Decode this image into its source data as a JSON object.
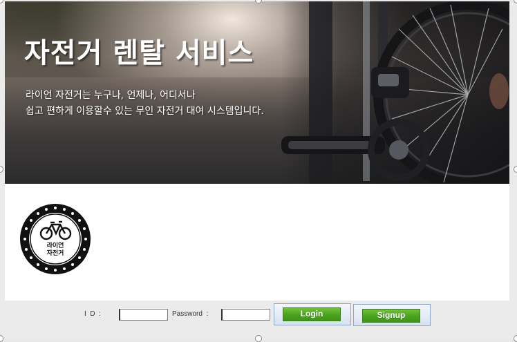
{
  "banner": {
    "title": "자전거 렌탈 서비스",
    "subtitle_line1": "라이언 자전거는 누구나, 언제나, 어디서나",
    "subtitle_line2": "쉽고 편하게 이용할수 있는 무인 자전거 대여 시스템입니다."
  },
  "logo": {
    "line1": "라이언",
    "line2": "자전거"
  },
  "login": {
    "id_label": "I  D  :",
    "id_value": "",
    "password_label": "Password  :",
    "password_value": "",
    "login_button": "Login",
    "signup_button": "Signup"
  },
  "colors": {
    "button_green": "#4aa21f",
    "button_frame": "#8aa6c8",
    "background": "#ebebeb"
  }
}
